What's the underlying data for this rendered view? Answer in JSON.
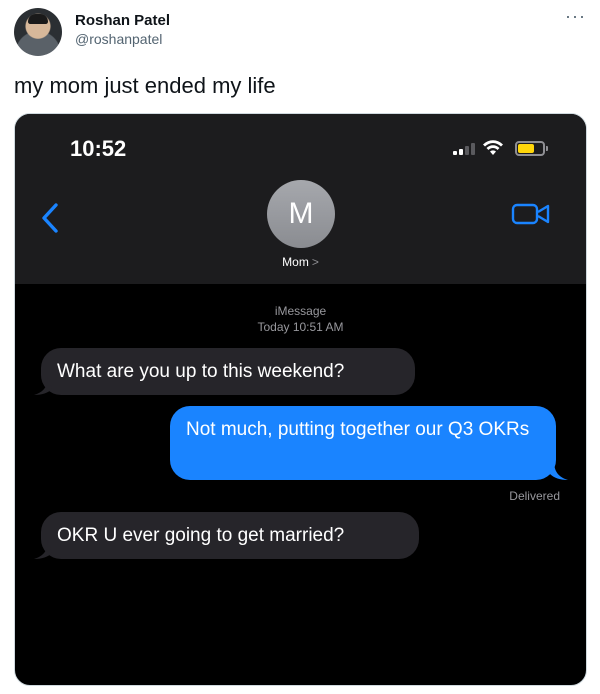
{
  "tweet": {
    "author_name": "Roshan Patel",
    "author_handle": "@roshanpatel",
    "more_label": "···",
    "text": "my mom just ended my life"
  },
  "phone": {
    "status_time": "10:52",
    "battery_color": "#ffd60a",
    "accent_color": "#1a84ff",
    "contact_initial": "M",
    "contact_name": "Mom",
    "contact_chevron": ">",
    "service_label": "iMessage",
    "service_timestamp": "Today 10:51 AM",
    "messages": [
      {
        "direction": "received",
        "text": "What are you up to this weekend?"
      },
      {
        "direction": "sent",
        "text": "Not much, putting together our Q3 OKRs"
      },
      {
        "direction": "received",
        "text": "OKR U ever going to get married?"
      }
    ],
    "delivered_label": "Delivered"
  }
}
